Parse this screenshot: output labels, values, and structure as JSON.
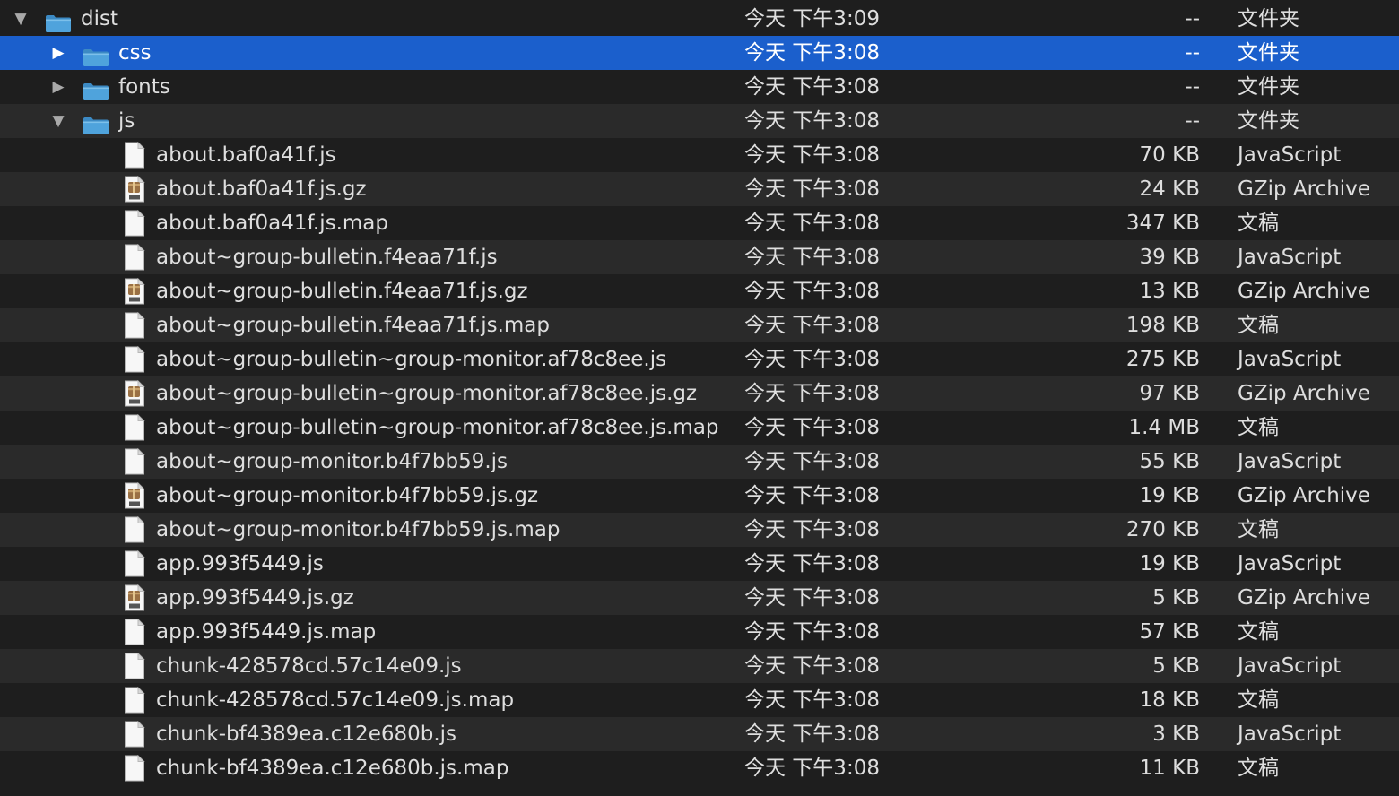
{
  "colors": {
    "background_odd": "#1e1e1e",
    "background_even": "#2a2a2a",
    "selection": "#1b5fcc",
    "text": "#dedede",
    "folder_blue": "#4fa3dc"
  },
  "rows": [
    {
      "name": "dist",
      "date": "今天 下午3:09",
      "size": "--",
      "kind": "文件夹",
      "icon": "folder-icon",
      "depth": 0,
      "disclosure": "open"
    },
    {
      "name": "css",
      "date": "今天 下午3:08",
      "size": "--",
      "kind": "文件夹",
      "icon": "folder-icon",
      "depth": 1,
      "disclosure": "closed",
      "selected": true
    },
    {
      "name": "fonts",
      "date": "今天 下午3:08",
      "size": "--",
      "kind": "文件夹",
      "icon": "folder-icon",
      "depth": 1,
      "disclosure": "closed"
    },
    {
      "name": "js",
      "date": "今天 下午3:08",
      "size": "--",
      "kind": "文件夹",
      "icon": "folder-icon",
      "depth": 1,
      "disclosure": "open"
    },
    {
      "name": "about.baf0a41f.js",
      "date": "今天 下午3:08",
      "size": "70 KB",
      "kind": "JavaScript",
      "icon": "document-icon",
      "depth": 2
    },
    {
      "name": "about.baf0a41f.js.gz",
      "date": "今天 下午3:08",
      "size": "24 KB",
      "kind": "GZip Archive",
      "icon": "gzip-archive-icon",
      "depth": 2
    },
    {
      "name": "about.baf0a41f.js.map",
      "date": "今天 下午3:08",
      "size": "347 KB",
      "kind": "文稿",
      "icon": "document-icon",
      "depth": 2
    },
    {
      "name": "about~group-bulletin.f4eaa71f.js",
      "date": "今天 下午3:08",
      "size": "39 KB",
      "kind": "JavaScript",
      "icon": "document-icon",
      "depth": 2
    },
    {
      "name": "about~group-bulletin.f4eaa71f.js.gz",
      "date": "今天 下午3:08",
      "size": "13 KB",
      "kind": "GZip Archive",
      "icon": "gzip-archive-icon",
      "depth": 2
    },
    {
      "name": "about~group-bulletin.f4eaa71f.js.map",
      "date": "今天 下午3:08",
      "size": "198 KB",
      "kind": "文稿",
      "icon": "document-icon",
      "depth": 2
    },
    {
      "name": "about~group-bulletin~group-monitor.af78c8ee.js",
      "date": "今天 下午3:08",
      "size": "275 KB",
      "kind": "JavaScript",
      "icon": "document-icon",
      "depth": 2
    },
    {
      "name": "about~group-bulletin~group-monitor.af78c8ee.js.gz",
      "date": "今天 下午3:08",
      "size": "97 KB",
      "kind": "GZip Archive",
      "icon": "gzip-archive-icon",
      "depth": 2
    },
    {
      "name": "about~group-bulletin~group-monitor.af78c8ee.js.map",
      "date": "今天 下午3:08",
      "size": "1.4 MB",
      "kind": "文稿",
      "icon": "document-icon",
      "depth": 2
    },
    {
      "name": "about~group-monitor.b4f7bb59.js",
      "date": "今天 下午3:08",
      "size": "55 KB",
      "kind": "JavaScript",
      "icon": "document-icon",
      "depth": 2
    },
    {
      "name": "about~group-monitor.b4f7bb59.js.gz",
      "date": "今天 下午3:08",
      "size": "19 KB",
      "kind": "GZip Archive",
      "icon": "gzip-archive-icon",
      "depth": 2
    },
    {
      "name": "about~group-monitor.b4f7bb59.js.map",
      "date": "今天 下午3:08",
      "size": "270 KB",
      "kind": "文稿",
      "icon": "document-icon",
      "depth": 2
    },
    {
      "name": "app.993f5449.js",
      "date": "今天 下午3:08",
      "size": "19 KB",
      "kind": "JavaScript",
      "icon": "document-icon",
      "depth": 2
    },
    {
      "name": "app.993f5449.js.gz",
      "date": "今天 下午3:08",
      "size": "5 KB",
      "kind": "GZip Archive",
      "icon": "gzip-archive-icon",
      "depth": 2
    },
    {
      "name": "app.993f5449.js.map",
      "date": "今天 下午3:08",
      "size": "57 KB",
      "kind": "文稿",
      "icon": "document-icon",
      "depth": 2
    },
    {
      "name": "chunk-428578cd.57c14e09.js",
      "date": "今天 下午3:08",
      "size": "5 KB",
      "kind": "JavaScript",
      "icon": "document-icon",
      "depth": 2
    },
    {
      "name": "chunk-428578cd.57c14e09.js.map",
      "date": "今天 下午3:08",
      "size": "18 KB",
      "kind": "文稿",
      "icon": "document-icon",
      "depth": 2
    },
    {
      "name": "chunk-bf4389ea.c12e680b.js",
      "date": "今天 下午3:08",
      "size": "3 KB",
      "kind": "JavaScript",
      "icon": "document-icon",
      "depth": 2
    },
    {
      "name": "chunk-bf4389ea.c12e680b.js.map",
      "date": "今天 下午3:08",
      "size": "11 KB",
      "kind": "文稿",
      "icon": "document-icon",
      "depth": 2
    }
  ]
}
